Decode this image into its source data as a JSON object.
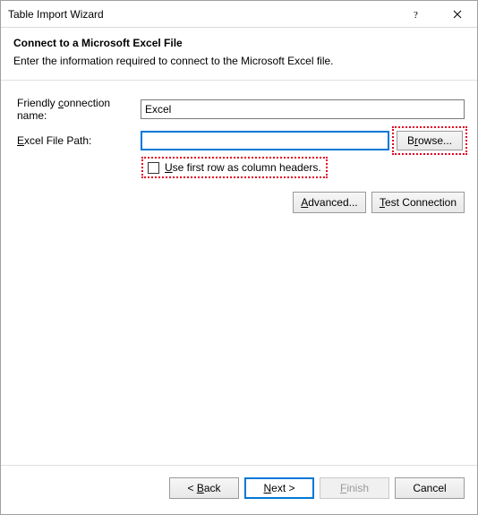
{
  "window": {
    "title": "Table Import Wizard"
  },
  "header": {
    "main": "Connect to a Microsoft Excel File",
    "sub": "Enter the information required to connect to the Microsoft Excel file."
  },
  "form": {
    "friendlyLabelPre": "Friendly ",
    "friendlyLabelAccel": "c",
    "friendlyLabelPost": "onnection name:",
    "friendlyValue": "Excel",
    "pathLabelAccel": "E",
    "pathLabelPost": "xcel File Path:",
    "pathValue": "",
    "browseAccel": "r",
    "browsePre": "B",
    "browsePost": "owse...",
    "checkboxAccel": "U",
    "checkboxPost": "se first row as column headers.",
    "advancedAccel": "A",
    "advancedPost": "dvanced...",
    "testAccel": "T",
    "testPost": "est Connection"
  },
  "footer": {
    "backPre": "< ",
    "backAccel": "B",
    "backPost": "ack",
    "nextAccel": "N",
    "nextPost": "ext >",
    "finishAccel": "F",
    "finishPost": "inish",
    "cancel": "Cancel"
  }
}
